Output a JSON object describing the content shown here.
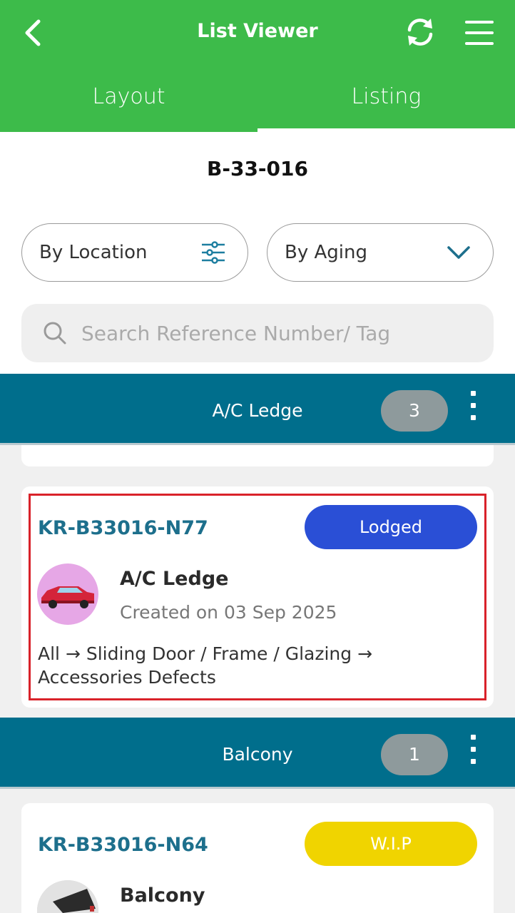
{
  "header": {
    "title": "List Viewer",
    "back_icon": "chevron-left-icon",
    "refresh_icon": "refresh-icon",
    "menu_icon": "hamburger-menu-icon",
    "tabs": [
      {
        "label": "Layout"
      },
      {
        "label": "Listing"
      }
    ],
    "active_tab": "Listing",
    "color": "#3dbb4a"
  },
  "unit": "B-33-016",
  "filters": {
    "location_label": "By Location",
    "aging_label": "By Aging"
  },
  "search": {
    "placeholder": "Search Reference Number/ Tag",
    "value": ""
  },
  "groups": [
    {
      "name": "A/C Ledge",
      "count": "3",
      "items": [
        {
          "ref": "KR-B33016-N77",
          "status": "Lodged",
          "status_color": "#2a4fd6",
          "location": "A/C Ledge",
          "created": "Created on 03 Sep 2025",
          "path": "All → Sliding Door / Frame / Glazing → Accessories Defects",
          "thumb_icon": "car-thumbnail"
        }
      ]
    },
    {
      "name": "Balcony",
      "count": "1",
      "items": [
        {
          "ref": "KR-B33016-N64",
          "status": "W.I.P",
          "status_color": "#f0d400",
          "location": "Balcony",
          "thumb_icon": "photo-thumbnail"
        }
      ]
    }
  ],
  "group_header_color": "#006e8c",
  "highlight_color": "#d9222a"
}
